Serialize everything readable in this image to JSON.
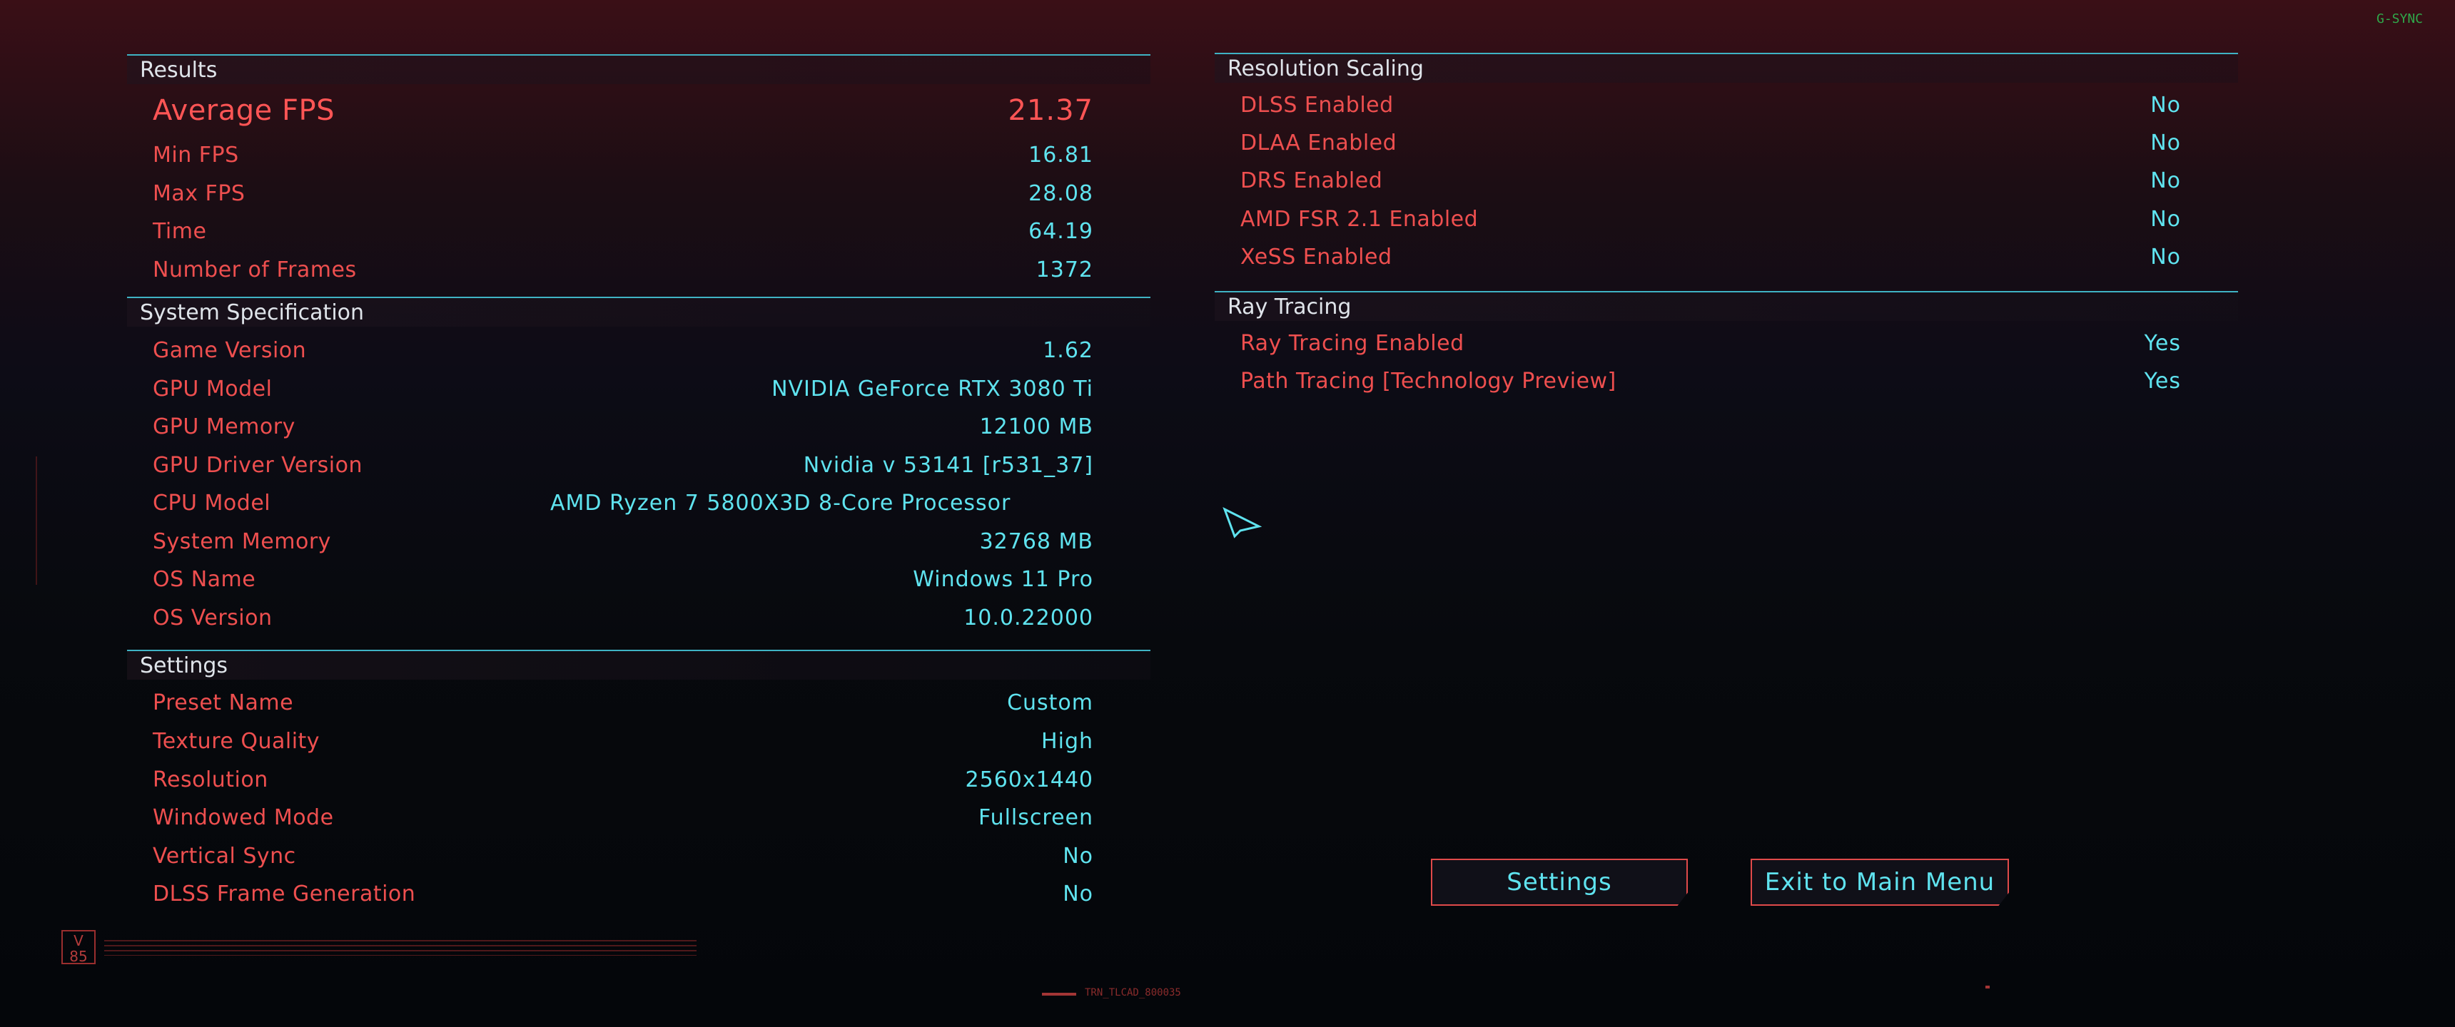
{
  "top_right_badge": "G-SYNC",
  "results": {
    "title": "Results",
    "rows": [
      {
        "label": "Average FPS",
        "value": "21.37"
      },
      {
        "label": "Min FPS",
        "value": "16.81"
      },
      {
        "label": "Max FPS",
        "value": "28.08"
      },
      {
        "label": "Time",
        "value": "64.19"
      },
      {
        "label": "Number of Frames",
        "value": "1372"
      }
    ]
  },
  "system": {
    "title": "System Specification",
    "rows": [
      {
        "label": "Game Version",
        "value": "1.62"
      },
      {
        "label": "GPU Model",
        "value": "NVIDIA GeForce RTX 3080 Ti"
      },
      {
        "label": "GPU Memory",
        "value": "12100 MB"
      },
      {
        "label": "GPU Driver Version",
        "value": "Nvidia v 53141 [r531_37]"
      },
      {
        "label": "CPU Model",
        "value": "AMD Ryzen 7 5800X3D 8-Core Processor"
      },
      {
        "label": "System Memory",
        "value": "32768 MB"
      },
      {
        "label": "OS Name",
        "value": "Windows 11 Pro"
      },
      {
        "label": "OS Version",
        "value": "10.0.22000"
      }
    ]
  },
  "settings": {
    "title": "Settings",
    "rows": [
      {
        "label": "Preset Name",
        "value": "Custom"
      },
      {
        "label": "Texture Quality",
        "value": "High"
      },
      {
        "label": "Resolution",
        "value": "2560x1440"
      },
      {
        "label": "Windowed Mode",
        "value": "Fullscreen"
      },
      {
        "label": "Vertical Sync",
        "value": "No"
      },
      {
        "label": "DLSS Frame Generation",
        "value": "No"
      }
    ]
  },
  "resolution_scaling": {
    "title": "Resolution Scaling",
    "rows": [
      {
        "label": "DLSS Enabled",
        "value": "No"
      },
      {
        "label": "DLAA Enabled",
        "value": "No"
      },
      {
        "label": "DRS Enabled",
        "value": "No"
      },
      {
        "label": "AMD FSR 2.1 Enabled",
        "value": "No"
      },
      {
        "label": "XeSS Enabled",
        "value": "No"
      }
    ]
  },
  "ray_tracing": {
    "title": "Ray Tracing",
    "rows": [
      {
        "label": "Ray Tracing Enabled",
        "value": "Yes"
      },
      {
        "label": "Path Tracing [Technology Preview]",
        "value": "Yes"
      }
    ]
  },
  "buttons": {
    "settings": "Settings",
    "exit": "Exit to Main Menu"
  },
  "footer": {
    "version_badge": "V 85",
    "build_code": "TRN_TLCAD_800035"
  },
  "colors": {
    "label_red": "#ee4f4f",
    "value_cyan": "#5fe3ef",
    "divider_cyan": "#3fb3c4",
    "header_text": "#dfe4ea"
  }
}
